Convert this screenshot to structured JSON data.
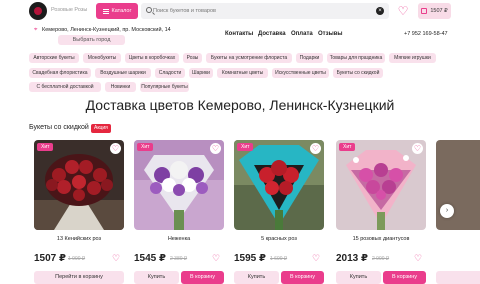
{
  "header": {
    "brand": "Розовые Розы",
    "catalog_label": "Каталог",
    "search_placeholder": "Поиск букетов и товаров",
    "cart_total": "1507 ₽"
  },
  "subheader": {
    "address": "Кемерово, Ленинск-Кузнецкий, пр. Московский, 14",
    "choose_store": "Выбрать город",
    "nav": [
      "Контакты",
      "Доставка",
      "Оплата",
      "Отзывы"
    ],
    "phone": "+7 952 169-58-47"
  },
  "categories": [
    "Авторские букеты",
    "Монобукеты",
    "Цветы в коробочках",
    "Розы",
    "Букеты на усмотрение флориста",
    "Подарки",
    "Товары для праздника",
    "Мягкие игрушки",
    "Свадебная флористика",
    "Воздушные шарики",
    "Сладости",
    "Шарики",
    "Комнатные цветы",
    "Искусственные цветы",
    "Букеты со скидкой",
    "С бесплатной доставкой",
    "Новинки",
    "Популярные букеты"
  ],
  "page_title": "Доставка цветов Кемерово, Ленинск-Кузнецкий",
  "section": {
    "title": "Букеты со скидкой",
    "badge": "Акция"
  },
  "products": [
    {
      "badge": "Хит",
      "name": "13 Кенийских роз",
      "price": "1507 ₽",
      "old_price": "1 990 ₽",
      "action": "Перейти в корзину"
    },
    {
      "badge": "Хит",
      "name": "Неженка",
      "price": "1545 ₽",
      "old_price": "2 380 ₽",
      "buy": "Купить",
      "cart": "В корзину"
    },
    {
      "badge": "Хит",
      "name": "5 красных роз",
      "price": "1595 ₽",
      "old_price": "1 690 ₽",
      "buy": "Купить",
      "cart": "В корзину"
    },
    {
      "badge": "Хит",
      "name": "15 розовых диантусов",
      "price": "2013 ₽",
      "old_price": "2 990 ₽",
      "buy": "Купить",
      "cart": "В корзину"
    }
  ],
  "colors": {
    "accent": "#ea3d8c",
    "accent_light": "#f9e1ec",
    "sale": "#e5273f"
  }
}
